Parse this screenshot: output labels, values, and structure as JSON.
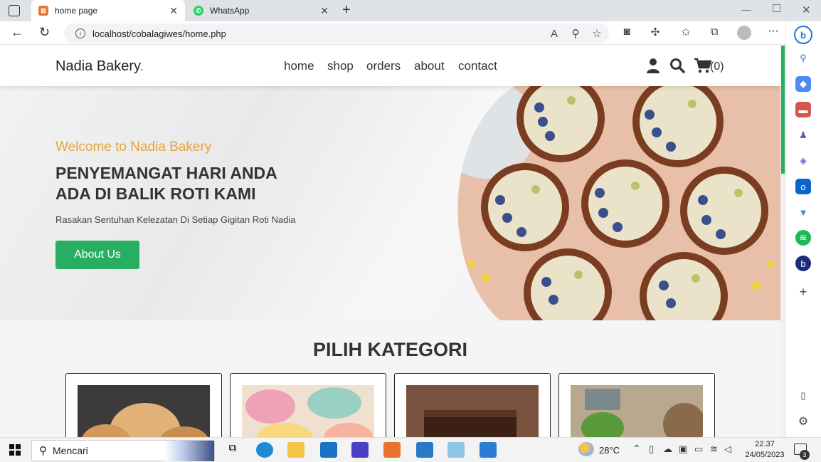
{
  "browser": {
    "tabs": [
      {
        "title": "home page"
      },
      {
        "title": "WhatsApp"
      }
    ],
    "url": "localhost/cobalagiwes/home.php"
  },
  "site": {
    "logo": "Nadia Bakery",
    "logo_dot": ".",
    "nav": [
      "home",
      "shop",
      "orders",
      "about",
      "contact"
    ],
    "cart_count": "(0)"
  },
  "hero": {
    "welcome": "Welcome to Nadia Bakery",
    "headline_line1": "PENYEMANGAT HARI ANDA",
    "headline_line2": "ADA DI BALIK ROTI KAMI",
    "tagline": "Rasakan Sentuhan Kelezatan Di Setiap Gigitan Roti Nadia",
    "button": "About Us"
  },
  "category_title": "PILIH KATEGORI",
  "taskbar": {
    "search_placeholder": "Mencari",
    "weather": "28°C",
    "time": "22.37",
    "date": "24/05/2023",
    "notifications": "3"
  },
  "colors": {
    "accent": "#27ae60",
    "welcome": "#e8a33c"
  }
}
